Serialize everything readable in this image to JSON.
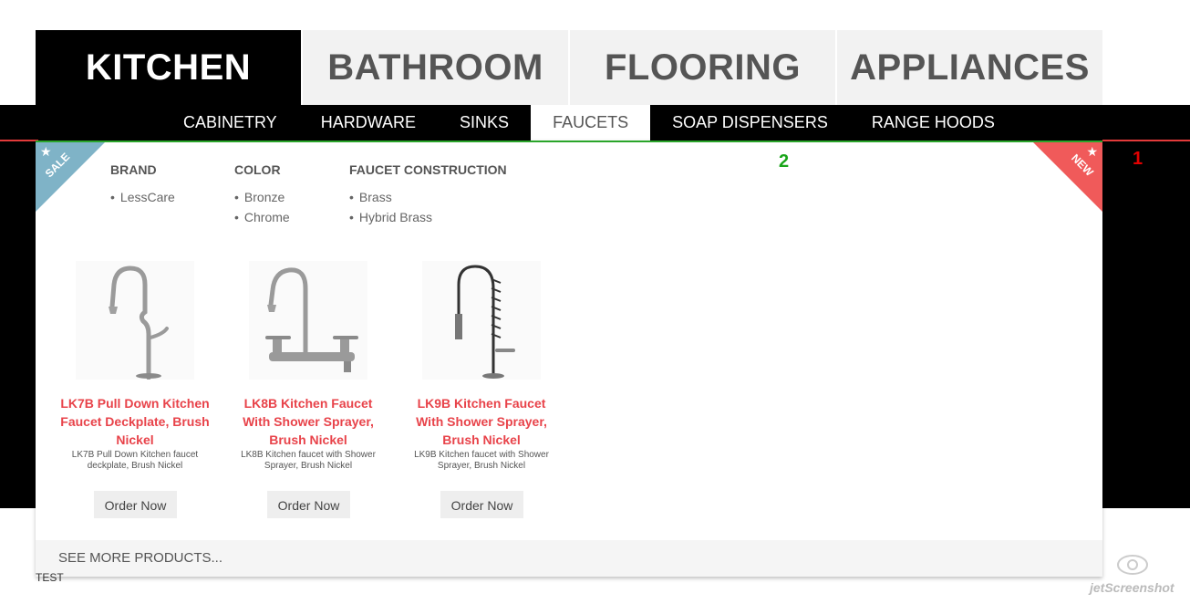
{
  "top_tabs": [
    {
      "label": "KITCHEN",
      "active": true
    },
    {
      "label": "BATHROOM",
      "active": false
    },
    {
      "label": "FLOORING",
      "active": false
    },
    {
      "label": "APPLIANCES",
      "active": false
    }
  ],
  "sub_nav": [
    {
      "label": "CABINETRY",
      "active": false
    },
    {
      "label": "HARDWARE",
      "active": false
    },
    {
      "label": "SINKS",
      "active": false
    },
    {
      "label": "FAUCETS",
      "active": true
    },
    {
      "label": "SOAP DISPENSERS",
      "active": false
    },
    {
      "label": "RANGE HOODS",
      "active": false
    }
  ],
  "markers": {
    "red": "1",
    "green": "2"
  },
  "ribbons": {
    "sale": "SALE",
    "new": "NEW"
  },
  "filters": [
    {
      "heading": "BRAND",
      "items": [
        "LessCare"
      ]
    },
    {
      "heading": "COLOR",
      "items": [
        "Bronze",
        "Chrome"
      ]
    },
    {
      "heading": "FAUCET CONSTRUCTION",
      "items": [
        "Brass",
        "Hybrid Brass"
      ]
    }
  ],
  "products": [
    {
      "title": "LK7B Pull Down Kitchen Faucet Deckplate, Brush Nickel",
      "desc": "LK7B Pull Down Kitchen faucet deckplate, Brush Nickel",
      "button": "Order Now"
    },
    {
      "title": "LK8B Kitchen Faucet With Shower Sprayer, Brush Nickel",
      "desc": "LK8B Kitchen faucet with Shower Sprayer, Brush Nickel",
      "button": "Order Now"
    },
    {
      "title": "LK9B Kitchen Faucet With Shower Sprayer, Brush Nickel",
      "desc": "LK9B Kitchen faucet with Shower Sprayer, Brush Nickel",
      "button": "Order Now"
    }
  ],
  "see_more": "SEE MORE PRODUCTS...",
  "test_label": "TEST",
  "watermark": "jetScreenshot",
  "colors": {
    "accent_red": "#e8434a",
    "green_border": "#2aa52a",
    "sale_ribbon": "#7fb3c7",
    "new_ribbon": "#f05a5a"
  }
}
